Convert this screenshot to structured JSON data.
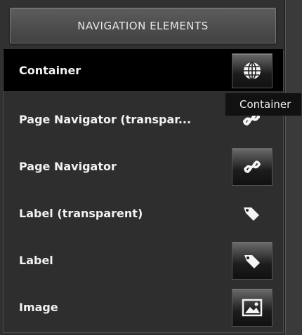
{
  "panel": {
    "header": "NAVIGATION ELEMENTS",
    "items": [
      {
        "label": "Container",
        "icon": "globe-icon",
        "selected": true
      },
      {
        "label": "Page Navigator (transpar...",
        "icon": "link-icon"
      },
      {
        "label": "Page Navigator",
        "icon": "link-icon"
      },
      {
        "label": "Label (transparent)",
        "icon": "tag-icon"
      },
      {
        "label": "Label",
        "icon": "tag-icon"
      },
      {
        "label": "Image",
        "icon": "image-icon"
      }
    ]
  },
  "tooltip": {
    "text": "Container"
  }
}
